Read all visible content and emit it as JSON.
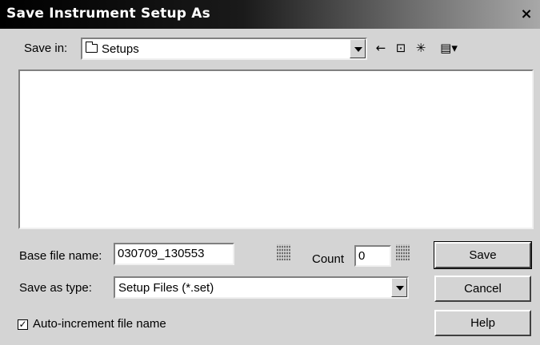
{
  "window": {
    "title": "Save Instrument Setup As",
    "close_glyph": "×"
  },
  "save_in": {
    "label": "Save in:",
    "value": "Setups"
  },
  "toolbar": {
    "back_glyph": "←",
    "up_folder_glyph": "⊡",
    "new_folder_glyph": "✳",
    "view_menu_glyph": "▤▾"
  },
  "form": {
    "base_file_name_label": "Base file name:",
    "base_file_name_value": "030709_130553",
    "count_label": "Count",
    "count_value": "0",
    "save_as_type_label": "Save as type:",
    "save_as_type_value": "Setup Files (*.set)",
    "auto_increment_label": "Auto-increment file name",
    "auto_increment_checked": "✓"
  },
  "buttons": {
    "save": "Save",
    "cancel": "Cancel",
    "help": "Help"
  },
  "colors": {
    "title_bar_start": "#000000",
    "title_bar_end": "#a8a8a8",
    "dialog_bg": "#d4d4d4"
  }
}
